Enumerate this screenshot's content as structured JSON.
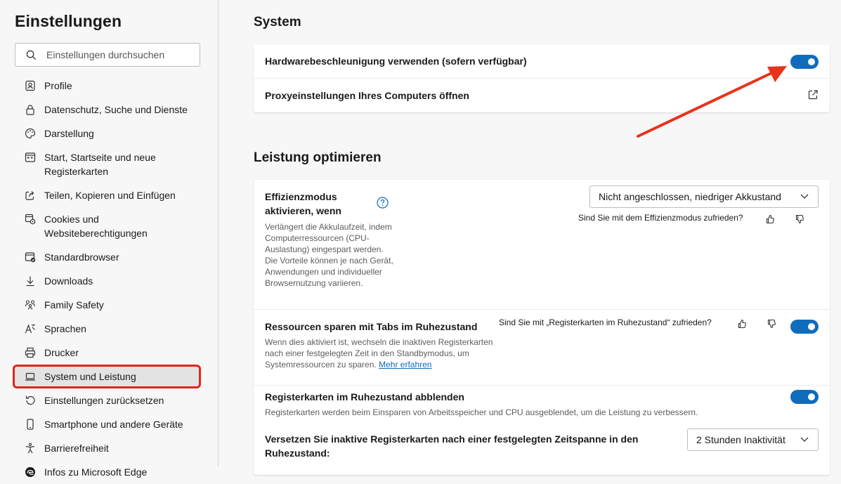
{
  "sidebar": {
    "title": "Einstellungen",
    "search": {
      "placeholder": "Einstellungen durchsuchen"
    },
    "items": [
      {
        "label": "Profile",
        "icon": "profile-icon"
      },
      {
        "label": "Datenschutz, Suche und Dienste",
        "icon": "lock-icon"
      },
      {
        "label": "Darstellung",
        "icon": "palette-icon"
      },
      {
        "label": "Start, Startseite und neue Registerkarten",
        "icon": "home-grid-icon"
      },
      {
        "label": "Teilen, Kopieren und Einfügen",
        "icon": "share-icon"
      },
      {
        "label": "Cookies und Websiteberechtigungen",
        "icon": "cookies-icon"
      },
      {
        "label": "Standardbrowser",
        "icon": "browser-check-icon"
      },
      {
        "label": "Downloads",
        "icon": "download-icon"
      },
      {
        "label": "Family Safety",
        "icon": "family-icon"
      },
      {
        "label": "Sprachen",
        "icon": "language-icon"
      },
      {
        "label": "Drucker",
        "icon": "printer-icon"
      },
      {
        "label": "System und Leistung",
        "icon": "laptop-icon",
        "active": true
      },
      {
        "label": "Einstellungen zurücksetzen",
        "icon": "reset-icon"
      },
      {
        "label": "Smartphone und andere Geräte",
        "icon": "phone-icon"
      },
      {
        "label": "Barrierefreiheit",
        "icon": "accessibility-icon"
      },
      {
        "label": "Infos zu Microsoft Edge",
        "icon": "edge-logo-icon"
      }
    ]
  },
  "system": {
    "title": "System",
    "hardware_accel": {
      "label": "Hardwarebeschleunigung verwenden (sofern verfügbar)",
      "enabled": true
    },
    "proxy": {
      "label": "Proxyeinstellungen Ihres Computers öffnen",
      "icon": "external-link-icon"
    }
  },
  "performance": {
    "title": "Leistung optimieren",
    "efficiency": {
      "label": "Effizienzmodus aktivieren, wenn",
      "description": "Verlängert die Akkulaufzeit, indem Computerressourcen (CPU-Auslastung) eingespart werden. Die Vorteile können je nach Gerät, Anwendungen und individueller Browsernutzung variieren.",
      "selected": "Nicht angeschlossen, niedriger Akkustand",
      "feedback": "Sind Sie mit dem Effizienzmodus zufrieden?"
    },
    "sleeping_tabs": {
      "label": "Ressourcen sparen mit Tabs im Ruhezustand",
      "description": "Wenn dies aktiviert ist, wechseln die inaktiven Registerkarten nach einer festgelegten Zeit in den Standbymodus, um Systemressourcen zu sparen.",
      "link": "Mehr erfahren",
      "feedback": "Sind Sie mit „Registerkarten im Ruhezustand“ zufrieden?",
      "enabled": true
    },
    "fade_tabs": {
      "label": "Registerkarten im Ruhezustand abblenden",
      "description": "Registerkarten werden beim Einsparen von Arbeitsspeicher und CPU ausgeblendet, um die Leistung zu verbessern.",
      "enabled": true
    },
    "inactive_timeout": {
      "label": "Versetzen Sie inaktive Registerkarten nach einer festgelegten Zeitspanne in den Ruhezustand:",
      "selected": "2 Stunden Inaktivität"
    }
  },
  "colors": {
    "accent": "#0f6cbd",
    "highlight": "#e0261b",
    "arrow": "#e8331c"
  }
}
